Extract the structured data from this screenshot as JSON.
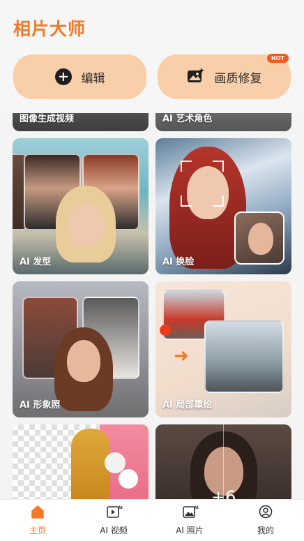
{
  "app_title": "相片大师",
  "actions": {
    "edit_label": "编辑",
    "enhance_label": "画质修复",
    "hot_badge": "HOT"
  },
  "cards": [
    {
      "label": "图像生成视频"
    },
    {
      "label": "AI 艺术角色"
    },
    {
      "label": "AI 发型"
    },
    {
      "label": "AI 换脸"
    },
    {
      "label": "AI 形象照"
    },
    {
      "label": "AI 局部重绘"
    },
    {
      "label": ""
    },
    {
      "label": ""
    }
  ],
  "more_count": "+6",
  "tabs": [
    {
      "label": "主页",
      "icon": "home-icon",
      "active": true
    },
    {
      "label": "AI 视频",
      "icon": "ai-video-icon",
      "active": false
    },
    {
      "label": "AI 照片",
      "icon": "ai-photo-icon",
      "active": false
    },
    {
      "label": "我的",
      "icon": "profile-icon",
      "active": false
    }
  ],
  "colors": {
    "accent": "#f07a2a",
    "button_bg": "#f8cfa9",
    "hot": "#f45a1b"
  }
}
